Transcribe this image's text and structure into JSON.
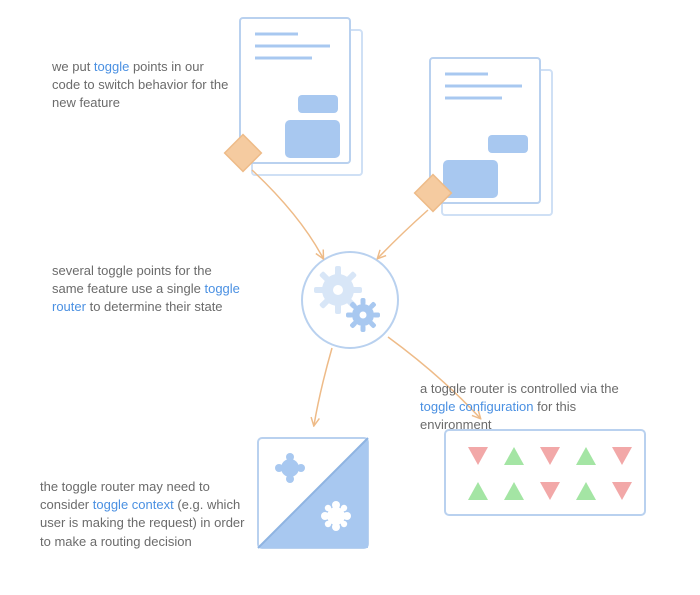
{
  "colors": {
    "blue_fill": "#a8c8f0",
    "blue_light": "#d8e6f7",
    "blue_stroke": "#9fc0ea",
    "orange_fill": "#f5cba0",
    "orange_stroke": "#eebb88",
    "green_fill": "#a4e5a4",
    "red_fill": "#f2a8a8",
    "text_gray": "#6b6b6b",
    "text_blue": "#4a90e2"
  },
  "captions": {
    "toggle_points_pre": "we put ",
    "toggle_points_hl": "toggle",
    "toggle_points_post": " points in our code to switch behavior for the new feature",
    "router_pre": "several toggle points for the same feature use a single ",
    "router_hl": "toggle router",
    "router_post": " to determine their state",
    "config_pre": "a toggle router is controlled via the ",
    "config_hl": "toggle configuration",
    "config_post": " for this environment",
    "context_pre": "the toggle router may need to consider ",
    "context_hl": "toggle context",
    "context_post": " (e.g. which user is making the request) in order to make a routing decision"
  },
  "icons": {
    "document_left": "document-icon",
    "document_right": "document-icon",
    "diamond_left": "toggle-point-diamond-icon",
    "diamond_right": "toggle-point-diamond-icon",
    "gears": "gears-icon",
    "context_card": "context-icon",
    "config_card": "config-triangles-icon"
  }
}
